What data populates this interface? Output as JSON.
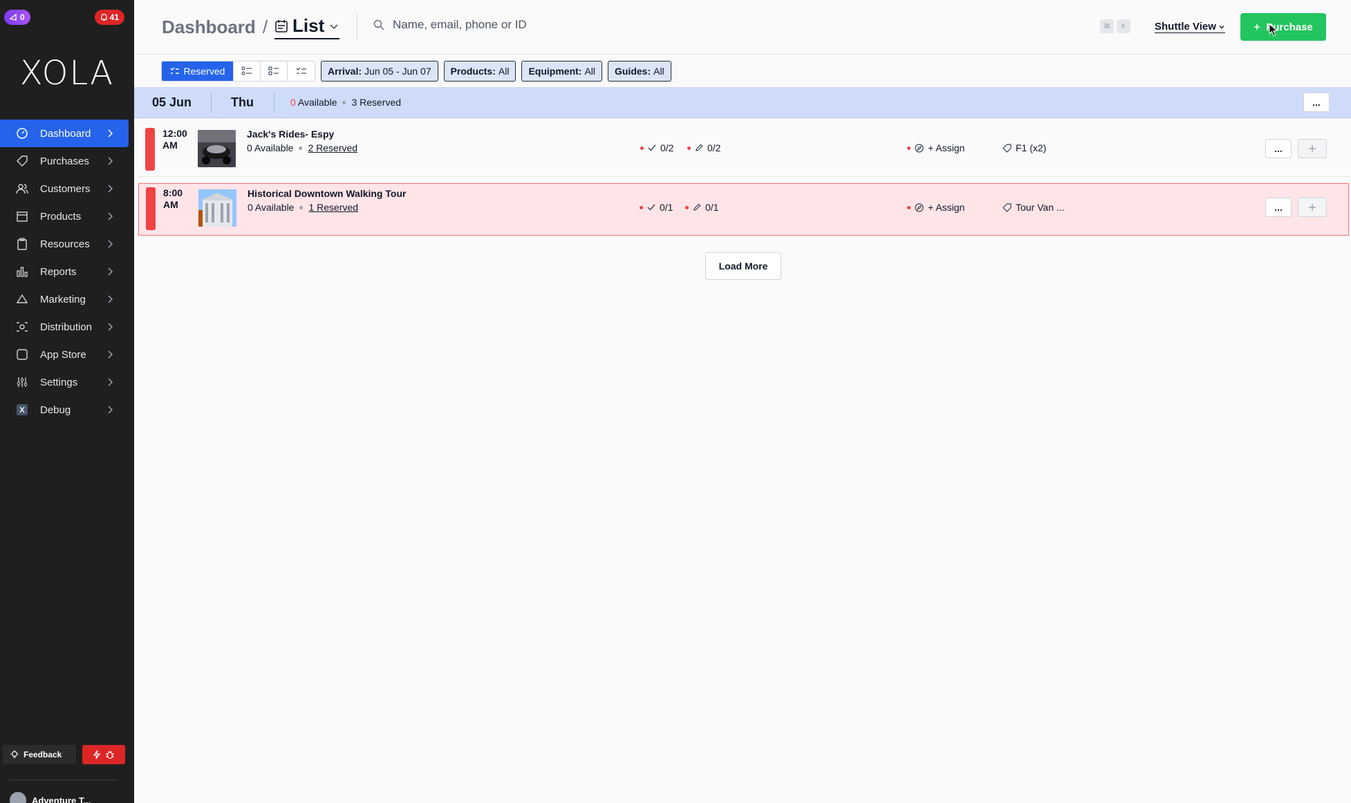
{
  "top_badges": {
    "left": "0",
    "right": "41"
  },
  "brand": "XOLA",
  "sidebar": {
    "items": [
      {
        "label": "Dashboard",
        "icon": "dashboard-icon"
      },
      {
        "label": "Purchases",
        "icon": "tag-icon"
      },
      {
        "label": "Customers",
        "icon": "users-icon"
      },
      {
        "label": "Products",
        "icon": "box-icon"
      },
      {
        "label": "Resources",
        "icon": "clipboard-icon"
      },
      {
        "label": "Reports",
        "icon": "bar-chart-icon"
      },
      {
        "label": "Marketing",
        "icon": "megaphone-icon"
      },
      {
        "label": "Distribution",
        "icon": "distribution-icon"
      },
      {
        "label": "App Store",
        "icon": "app-store-icon"
      },
      {
        "label": "Settings",
        "icon": "sliders-icon"
      },
      {
        "label": "Debug",
        "icon": "debug-x-icon"
      }
    ],
    "active": "Dashboard",
    "feedback_label": "Feedback",
    "account_label": "Adventure T..."
  },
  "header": {
    "breadcrumb": "Dashboard",
    "separator": "/",
    "view": "List",
    "search_placeholder": "Name, email, phone or ID",
    "kbd1": "⌘",
    "kbd2": "K",
    "shuttle_view": "Shuttle View",
    "purchase_label": "Purchase"
  },
  "filters": {
    "reserved_label": "Reserved",
    "arrival": {
      "key": "Arrival:",
      "value": "Jun 05 - Jun 07"
    },
    "products": {
      "key": "Products:",
      "value": "All"
    },
    "equipment": {
      "key": "Equipment:",
      "value": "All"
    },
    "guides": {
      "key": "Guides:",
      "value": "All"
    }
  },
  "date_row": {
    "date": "05 Jun",
    "weekday": "Thu",
    "available_count": "0",
    "available_label": "Available",
    "reserved": "3 Reserved",
    "more": "..."
  },
  "rows": [
    {
      "time_line1": "12:00",
      "time_line2": "AM",
      "title": "Jack's Rides- Espy",
      "available": "0 Available",
      "reserved": "2 Reserved",
      "checked_in": "0/2",
      "waivers": "0/2",
      "assign": "+ Assign",
      "equipment": "F1 (x2)"
    },
    {
      "time_line1": "8:00",
      "time_line2": "AM",
      "title": "Historical Downtown Walking Tour",
      "available": "0 Available",
      "reserved": "1 Reserved",
      "checked_in": "0/1",
      "waivers": "0/1",
      "assign": "+ Assign",
      "equipment": "Tour Van ..."
    }
  ],
  "load_more": "Load More",
  "colors": {
    "sidebar_bg": "#1f1f1f",
    "accent": "#2563eb",
    "purchase": "#22c55e",
    "alert": "#ef4444",
    "date_row": "#cfdcf9",
    "row_highlight": "#ffe4e8"
  }
}
